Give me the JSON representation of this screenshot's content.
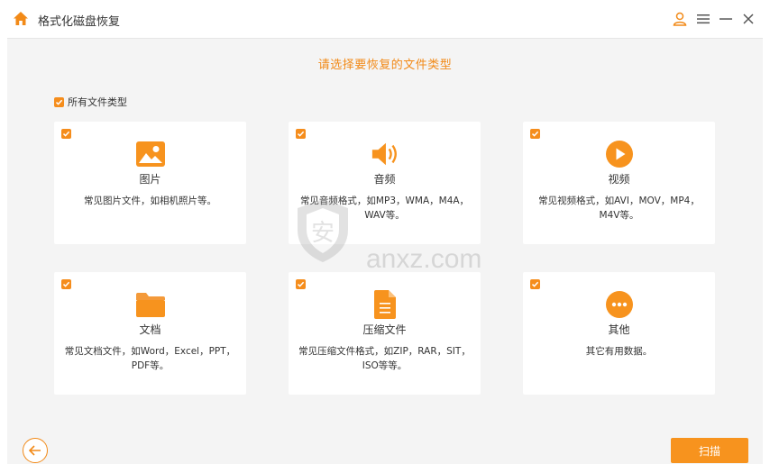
{
  "window": {
    "title": "格式化磁盘恢复"
  },
  "main": {
    "heading": "请选择要恢复的文件类型",
    "all_types_label": "所有文件类型"
  },
  "cards": [
    {
      "name": "图片",
      "desc": "常见图片文件，如相机照片等。",
      "icon": "image-icon"
    },
    {
      "name": "音频",
      "desc": "常见音频格式，如MP3，WMA，M4A，WAV等。",
      "icon": "audio-icon"
    },
    {
      "name": "视频",
      "desc": "常见视频格式，如AVI，MOV，MP4，M4V等。",
      "icon": "video-icon"
    },
    {
      "name": "文档",
      "desc": "常见文档文件，如Word，Excel，PPT，PDF等。",
      "icon": "folder-icon"
    },
    {
      "name": "压缩文件",
      "desc": "常见压缩文件格式，如ZIP，RAR，SIT，ISO等等。",
      "icon": "archive-file-icon"
    },
    {
      "name": "其他",
      "desc": "其它有用数据。",
      "icon": "more-icon"
    }
  ],
  "footer": {
    "scan_label": "扫描"
  },
  "watermark": {
    "text": "anxz.com"
  },
  "colors": {
    "accent": "#f7931e",
    "heading": "#f28a18",
    "background": "#f4f4f4"
  }
}
